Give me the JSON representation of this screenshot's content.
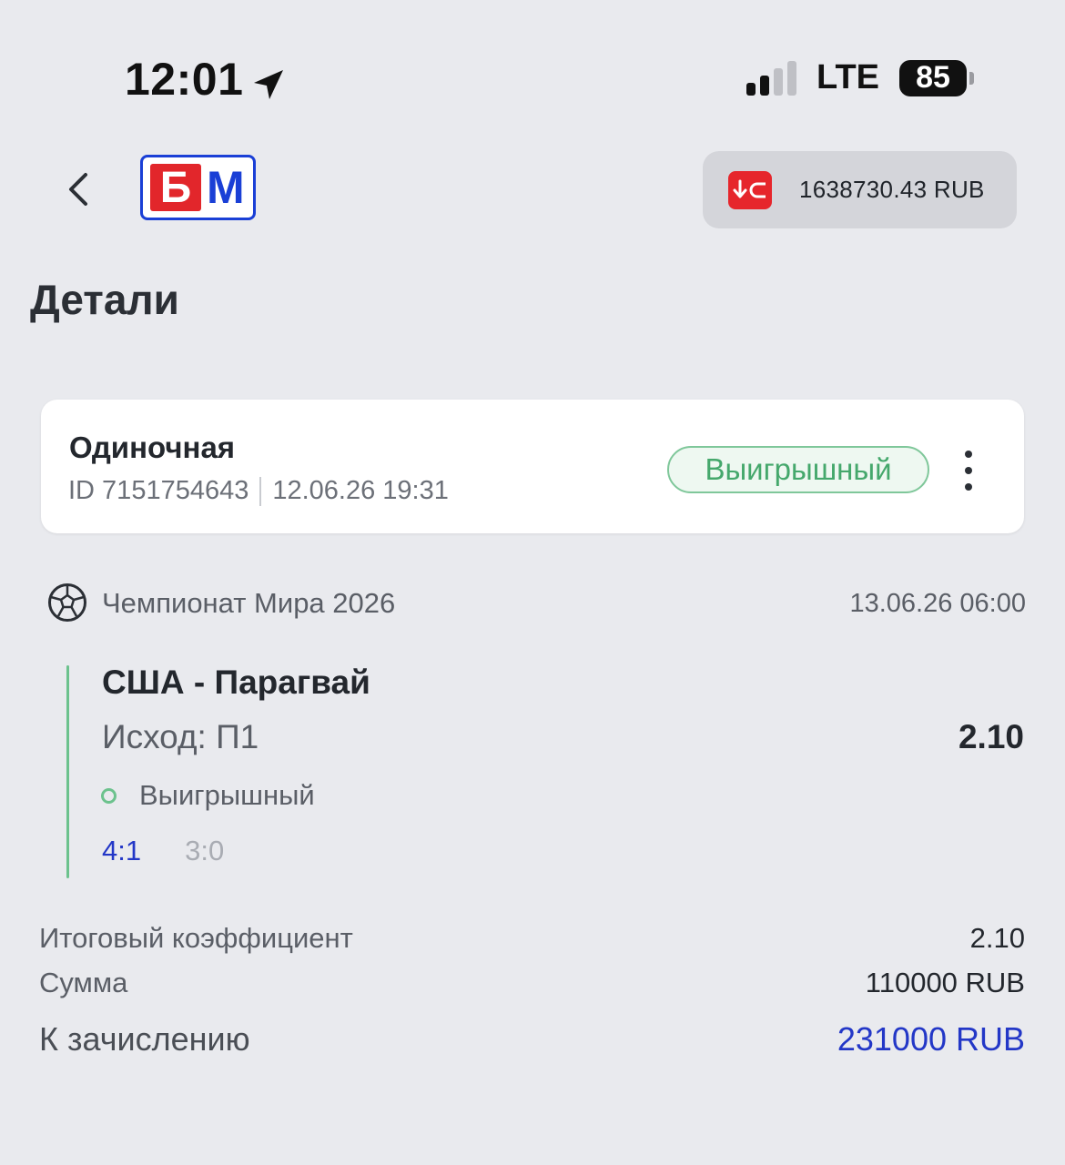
{
  "status_bar": {
    "time": "12:01",
    "network": "LTE",
    "battery": "85"
  },
  "header": {
    "logo_letter_1": "Б",
    "logo_letter_2": "М",
    "balance": "1638730.43 RUB"
  },
  "page": {
    "title": "Детали"
  },
  "bet": {
    "type": "Одиночная",
    "id": "ID 7151754643",
    "datetime": "12.06.26 19:31",
    "status": "Выигрышный"
  },
  "event": {
    "tournament": "Чемпионат Мира 2026",
    "date": "13.06.26 06:00",
    "match": "США - Парагвай",
    "outcome": "Исход: П1",
    "odds": "2.10",
    "result": "Выигрышный",
    "score_final": "4:1",
    "score_half": "3:0"
  },
  "summary": {
    "coef_label": "Итоговый коэффициент",
    "coef_value": "2.10",
    "sum_label": "Сумма",
    "sum_value": "110000 RUB",
    "payout_label": "К зачислению",
    "payout_value": "231000 RUB"
  },
  "icons": {
    "back": "chevron-left-icon",
    "location": "location-arrow-icon",
    "wallet": "wallet-icon",
    "sport": "soccer-ball-icon",
    "more": "more-vertical-icon"
  },
  "colors": {
    "background": "#e9eaee",
    "accent_blue": "#2337c7",
    "win_green": "#45a86c",
    "brand_red": "#e2262b"
  }
}
